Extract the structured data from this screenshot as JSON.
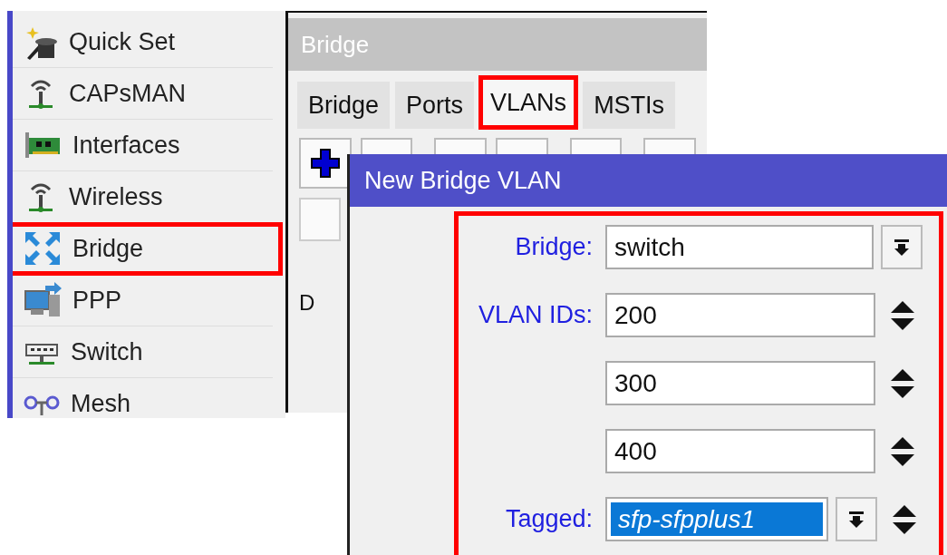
{
  "sidebar": {
    "items": [
      {
        "label": "Quick Set",
        "highlighted": false
      },
      {
        "label": "CAPsMAN",
        "highlighted": false
      },
      {
        "label": "Interfaces",
        "highlighted": false
      },
      {
        "label": "Wireless",
        "highlighted": false
      },
      {
        "label": "Bridge",
        "highlighted": true
      },
      {
        "label": "PPP",
        "highlighted": false
      },
      {
        "label": "Switch",
        "highlighted": false
      },
      {
        "label": "Mesh",
        "highlighted": false
      }
    ]
  },
  "bridge_window": {
    "title": "Bridge",
    "tabs": [
      {
        "label": "Bridge",
        "selected": false,
        "highlighted": false
      },
      {
        "label": "Ports",
        "selected": false,
        "highlighted": false
      },
      {
        "label": "VLANs",
        "selected": true,
        "highlighted": true
      },
      {
        "label": "MSTIs",
        "selected": false,
        "highlighted": false
      }
    ],
    "table": {
      "rows": [
        {
          "flag": "D"
        }
      ]
    }
  },
  "dialog": {
    "title": "New Bridge VLAN",
    "highlighted": true,
    "fields": [
      {
        "label": "Bridge:",
        "value": "switch",
        "kind": "dropdown",
        "selected": false
      },
      {
        "label": "VLAN IDs:",
        "value": "200",
        "kind": "spin",
        "selected": false
      },
      {
        "value": "300",
        "kind": "spin",
        "selected": false
      },
      {
        "value": "400",
        "kind": "spin",
        "selected": false
      },
      {
        "label": "Tagged:",
        "value": "sfp-sfpplus1",
        "kind": "dropdown-spin",
        "selected": true
      }
    ]
  }
}
